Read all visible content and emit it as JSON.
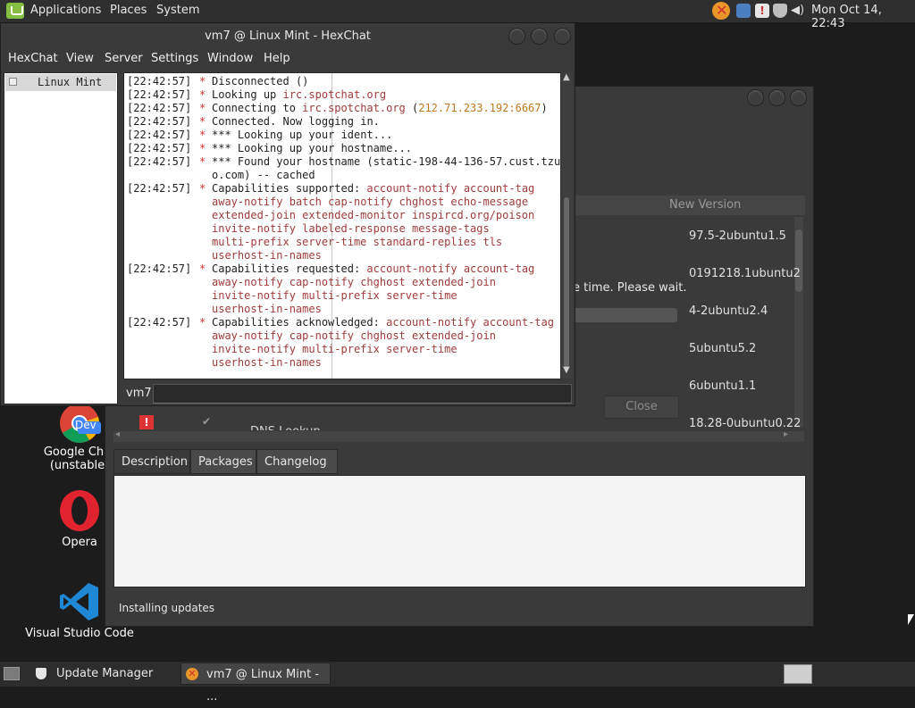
{
  "top_panel": {
    "menus": [
      "Applications",
      "Places",
      "System"
    ],
    "clock": "Mon Oct 14, 22:43"
  },
  "desktop": {
    "icons": [
      {
        "label": "Google Chrome\n(unstable)",
        "line1": "Google Chro",
        "line2": "(unstable)",
        "badge": "Dev",
        "icon": "chrome-icon"
      },
      {
        "label": "Opera",
        "icon": "opera-icon"
      },
      {
        "label": "Visual Studio Code",
        "icon": "vscode-icon"
      }
    ]
  },
  "update_manager": {
    "list_header_new_version": "New Version",
    "versions": [
      "97.5-2ubuntu1.5",
      "0191218.1ubuntu2",
      "4-2ubuntu2.4",
      "5ubuntu5.2",
      "6ubuntu1.1",
      "18.28-0ubuntu0.22"
    ],
    "progress_text": "e time. Please wait.",
    "close_button": "Close",
    "partial_item": "DNS Lookup Utility",
    "tabs": [
      "Description",
      "Packages",
      "Changelog"
    ],
    "status": "Installing updates"
  },
  "hexchat": {
    "title": "vm7 @ Linux Mint - HexChat",
    "menu": [
      "HexChat",
      "View",
      "Server",
      "Settings",
      "Window",
      "Help"
    ],
    "tree_item": "Linux Mint",
    "nick": "vm7",
    "messages": [
      {
        "ts": "[22:42:57]",
        "lines": [
          "Disconnected ()"
        ]
      },
      {
        "ts": "[22:42:57]",
        "lines": [
          "Looking up irc.spotchat.org"
        ]
      },
      {
        "ts": "[22:42:57]",
        "lines": [
          "Connecting to irc.spotchat.org (212.71.233.192:6667)"
        ]
      },
      {
        "ts": "[22:42:57]",
        "lines": [
          "Connected. Now logging in."
        ]
      },
      {
        "ts": "[22:42:57]",
        "lines": [
          "*** Looking up your ident..."
        ]
      },
      {
        "ts": "[22:42:57]",
        "lines": [
          "*** Looking up your hostname..."
        ]
      },
      {
        "ts": "[22:42:57]",
        "lines": [
          "*** Found your hostname (static-198-44-136-57.cust.tzul",
          "o.com) -- cached"
        ]
      },
      {
        "ts": "[22:42:57]",
        "lines": [
          "Capabilities supported: account-notify account-tag",
          "away-notify batch cap-notify chghost echo-message",
          "extended-join extended-monitor inspircd.org/poison",
          "invite-notify labeled-response message-tags",
          "multi-prefix server-time standard-replies tls",
          "userhost-in-names"
        ]
      },
      {
        "ts": "[22:42:57]",
        "lines": [
          "Capabilities requested: account-notify account-tag",
          "away-notify cap-notify chghost extended-join",
          "invite-notify multi-prefix server-time",
          "userhost-in-names"
        ]
      },
      {
        "ts": "[22:42:57]",
        "lines": [
          "Capabilities acknowledged: account-notify account-tag",
          "away-notify cap-notify chghost extended-join",
          "invite-notify multi-prefix server-time",
          "userhost-in-names"
        ]
      }
    ]
  },
  "taskbar": {
    "items": [
      "Update Manager",
      "vm7 @ Linux Mint - ..."
    ]
  }
}
